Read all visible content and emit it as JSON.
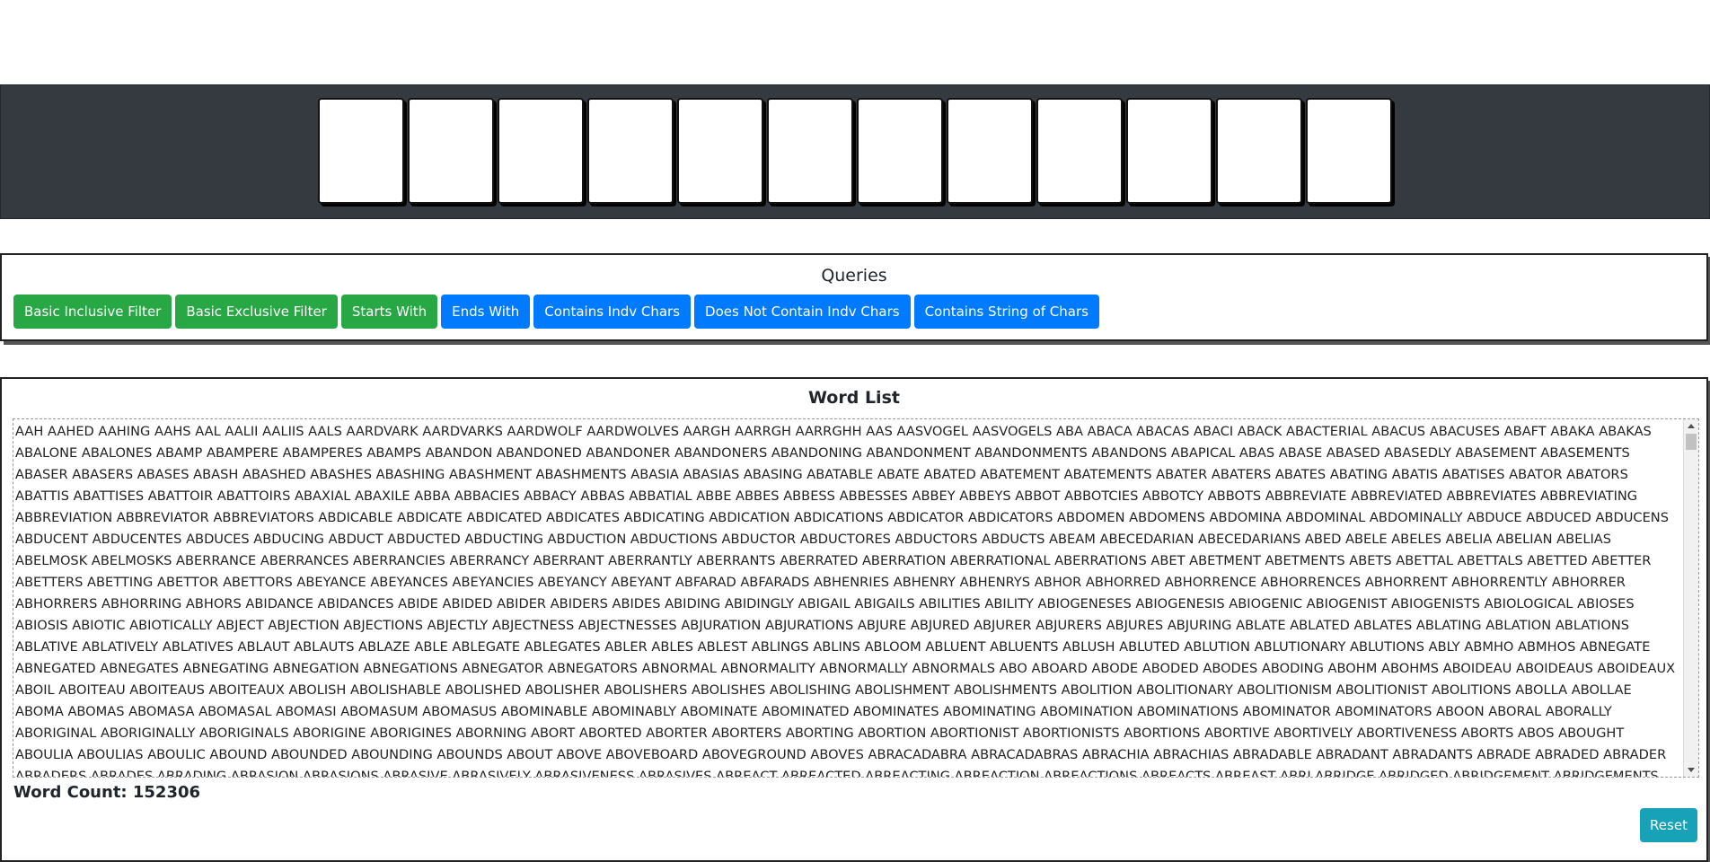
{
  "tiles": [
    "",
    "",
    "",
    "",
    "",
    "",
    "",
    "",
    "",
    "",
    "",
    ""
  ],
  "queries": {
    "title": "Queries",
    "buttons": [
      {
        "label": "Basic Inclusive Filter",
        "color": "#28a745"
      },
      {
        "label": "Basic Exclusive Filter",
        "color": "#28a745"
      },
      {
        "label": "Starts With",
        "color": "#28a745"
      },
      {
        "label": "Ends With",
        "color": "#007bff"
      },
      {
        "label": "Contains Indv Chars",
        "color": "#007bff"
      },
      {
        "label": "Does Not Contain Indv Chars",
        "color": "#007bff"
      },
      {
        "label": "Contains String of Chars",
        "color": "#007bff"
      }
    ]
  },
  "word_list": {
    "title": "Word List",
    "text": "AAH AAHED AAHING AAHS AAL AALII AALIIS AALS AARDVARK AARDVARKS AARDWOLF AARDWOLVES AARGH AARRGH AARRGHH AAS AASVOGEL AASVOGELS ABA ABACA ABACAS ABACI ABACK ABACTERIAL ABACUS ABACUSES ABAFT ABAKA ABAKAS ABALONE ABALONES ABAMP ABAMPERE ABAMPERES ABAMPS ABANDON ABANDONED ABANDONER ABANDONERS ABANDONING ABANDONMENT ABANDONMENTS ABANDONS ABAPICAL ABAS ABASE ABASED ABASEDLY ABASEMENT ABASEMENTS ABASER ABASERS ABASES ABASH ABASHED ABASHES ABASHING ABASHMENT ABASHMENTS ABASIA ABASIAS ABASING ABATABLE ABATE ABATED ABATEMENT ABATEMENTS ABATER ABATERS ABATES ABATING ABATIS ABATISES ABATOR ABATORS ABATTIS ABATTISES ABATTOIR ABATTOIRS ABAXIAL ABAXILE ABBA ABBACIES ABBACY ABBAS ABBATIAL ABBE ABBES ABBESS ABBESSES ABBEY ABBEYS ABBOT ABBOTCIES ABBOTCY ABBOTS ABBREVIATE ABBREVIATED ABBREVIATES ABBREVIATING ABBREVIATION ABBREVIATOR ABBREVIATORS ABDICABLE ABDICATE ABDICATED ABDICATES ABDICATING ABDICATION ABDICATIONS ABDICATOR ABDICATORS ABDOMEN ABDOMENS ABDOMINA ABDOMINAL ABDOMINALLY ABDUCE ABDUCED ABDUCENS ABDUCENT ABDUCENTES ABDUCES ABDUCING ABDUCT ABDUCTED ABDUCTING ABDUCTION ABDUCTIONS ABDUCTOR ABDUCTORES ABDUCTORS ABDUCTS ABEAM ABECEDARIAN ABECEDARIANS ABED ABELE ABELES ABELIA ABELIAN ABELIAS ABELMOSK ABELMOSKS ABERRANCE ABERRANCES ABERRANCIES ABERRANCY ABERRANT ABERRANTLY ABERRANTS ABERRATED ABERRATION ABERRATIONAL ABERRATIONS ABET ABETMENT ABETMENTS ABETS ABETTAL ABETTALS ABETTED ABETTER ABETTERS ABETTING ABETTOR ABETTORS ABEYANCE ABEYANCES ABEYANCIES ABEYANCY ABEYANT ABFARAD ABFARADS ABHENRIES ABHENRY ABHENRYS ABHOR ABHORRED ABHORRENCE ABHORRENCES ABHORRENT ABHORRENTLY ABHORRER ABHORRERS ABHORRING ABHORS ABIDANCE ABIDANCES ABIDE ABIDED ABIDER ABIDERS ABIDES ABIDING ABIDINGLY ABIGAIL ABIGAILS ABILITIES ABILITY ABIOGENESES ABIOGENESIS ABIOGENIC ABIOGENIST ABIOGENISTS ABIOLOGICAL ABIOSES ABIOSIS ABIOTIC ABIOTICALLY ABJECT ABJECTION ABJECTIONS ABJECTLY ABJECTNESS ABJECTNESSES ABJURATION ABJURATIONS ABJURE ABJURED ABJURER ABJURERS ABJURES ABJURING ABLATE ABLATED ABLATES ABLATING ABLATION ABLATIONS ABLATIVE ABLATIVELY ABLATIVES ABLAUT ABLAUTS ABLAZE ABLE ABLEGATE ABLEGATES ABLER ABLES ABLEST ABLINGS ABLINS ABLOOM ABLUENT ABLUENTS ABLUSH ABLUTED ABLUTION ABLUTIONARY ABLUTIONS ABLY ABMHO ABMHOS ABNEGATE ABNEGATED ABNEGATES ABNEGATING ABNEGATION ABNEGATIONS ABNEGATOR ABNEGATORS ABNORMAL ABNORMALITY ABNORMALLY ABNORMALS ABO ABOARD ABODE ABODED ABODES ABODING ABOHM ABOHMS ABOIDEAU ABOIDEAUS ABOIDEAUX ABOIL ABOITEAU ABOITEAUS ABOITEAUX ABOLISH ABOLISHABLE ABOLISHED ABOLISHER ABOLISHERS ABOLISHES ABOLISHING ABOLISHMENT ABOLISHMENTS ABOLITION ABOLITIONARY ABOLITIONISM ABOLITIONIST ABOLITIONS ABOLLA ABOLLAE ABOMA ABOMAS ABOMASA ABOMASAL ABOMASI ABOMASUM ABOMASUS ABOMINABLE ABOMINABLY ABOMINATE ABOMINATED ABOMINATES ABOMINATING ABOMINATION ABOMINATIONS ABOMINATOR ABOMINATORS ABOON ABORAL ABORALLY ABORIGINAL ABORIGINALLY ABORIGINALS ABORIGINE ABORIGINES ABORNING ABORT ABORTED ABORTER ABORTERS ABORTING ABORTION ABORTIONIST ABORTIONISTS ABORTIONS ABORTIVE ABORTIVELY ABORTIVENESS ABORTS ABOS ABOUGHT ABOULIA ABOULIAS ABOULIC ABOUND ABOUNDED ABOUNDING ABOUNDS ABOUT ABOVE ABOVEBOARD ABOVEGROUND ABOVES ABRACADABRA ABRACADABRAS ABRACHIA ABRACHIAS ABRADABLE ABRADANT ABRADANTS ABRADE ABRADED ABRADER ABRADERS ABRADES ABRADING ABRASION ABRASIONS ABRASIVE ABRASIVELY ABRASIVENESS ABRASIVES ABREACT ABREACTED ABREACTING ABREACTION ABREACTIONS ABREACTS ABREAST ABRI ABRIDGE ABRIDGED ABRIDGEMENT ABRIDGEMENTS ABRIDGER ABRIDGERS ABRIDGES"
  },
  "word_count_label": "Word Count: 152306",
  "reset_label": "Reset"
}
